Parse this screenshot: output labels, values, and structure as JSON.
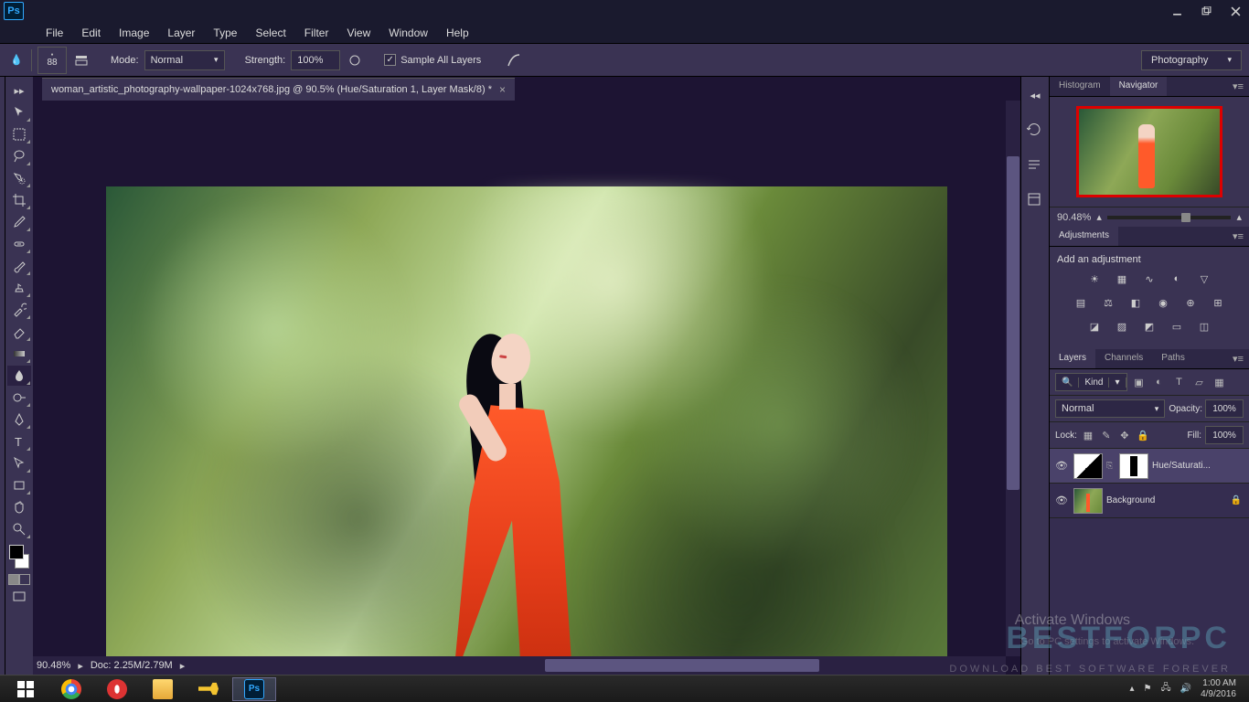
{
  "menu": {
    "file": "File",
    "edit": "Edit",
    "image": "Image",
    "layer": "Layer",
    "type": "Type",
    "select": "Select",
    "filter": "Filter",
    "view": "View",
    "window": "Window",
    "help": "Help"
  },
  "options": {
    "brush_size": "88",
    "mode_label": "Mode:",
    "mode_value": "Normal",
    "strength_label": "Strength:",
    "strength_value": "100%",
    "sample_all": "Sample All Layers",
    "workspace": "Photography"
  },
  "doc": {
    "tab_title": "woman_artistic_photography-wallpaper-1024x768.jpg @ 90.5% (Hue/Saturation 1, Layer Mask/8) *",
    "status_zoom": "90.48%",
    "status_doc": "Doc: 2.25M/2.79M"
  },
  "panels": {
    "histogram": "Histogram",
    "navigator": "Navigator",
    "nav_zoom": "90.48%",
    "adjustments": "Adjustments",
    "adj_add": "Add an adjustment",
    "layers": "Layers",
    "channels": "Channels",
    "paths": "Paths",
    "kind": "Kind",
    "blend_mode": "Normal",
    "opacity_label": "Opacity:",
    "opacity_value": "100%",
    "lock_label": "Lock:",
    "fill_label": "Fill:",
    "fill_value": "100%",
    "layer1": "Hue/Saturati...",
    "layer2": "Background"
  },
  "overlay": {
    "activate": "Activate Windows",
    "activate_sub": "Go to PC settings to activate Windows.",
    "watermark": "BESTFORPC",
    "watermark_sub": "DOWNLOAD BEST SOFTWARE FOREVER"
  },
  "tray": {
    "time": "1:00 AM",
    "date": "4/9/2016"
  }
}
